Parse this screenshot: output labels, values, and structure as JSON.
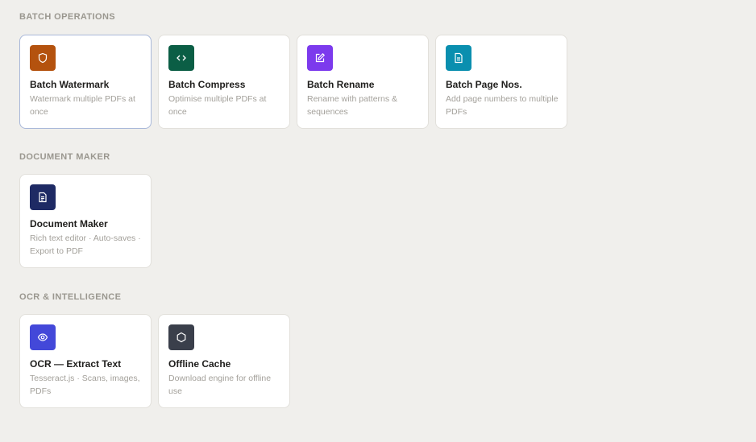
{
  "sections": [
    {
      "title": "BATCH OPERATIONS",
      "cards": [
        {
          "title": "Batch Watermark",
          "desc": "Watermark multiple PDFs at once",
          "icon": "shield-icon",
          "color": "#b4520e"
        },
        {
          "title": "Batch Compress",
          "desc": "Optimise multiple PDFs at once",
          "icon": "code-icon",
          "color": "#0b5e45"
        },
        {
          "title": "Batch Rename",
          "desc": "Rename with patterns & sequences",
          "icon": "edit-icon",
          "color": "#7c3aed"
        },
        {
          "title": "Batch Page Nos.",
          "desc": "Add page numbers to multiple PDFs",
          "icon": "file-icon",
          "color": "#0a8faf"
        }
      ]
    },
    {
      "title": "DOCUMENT MAKER",
      "cards": [
        {
          "title": "Document Maker",
          "desc": "Rich text editor · Auto-saves · Export to PDF",
          "icon": "document-icon",
          "color": "#1e2a64"
        }
      ]
    },
    {
      "title": "OCR & INTELLIGENCE",
      "cards": [
        {
          "title": "OCR — Extract Text",
          "desc": "Tesseract.js · Scans, images, PDFs",
          "icon": "eye-icon",
          "color": "#4348d9"
        },
        {
          "title": "Offline Cache",
          "desc": "Download engine for offline use",
          "icon": "hexagon-icon",
          "color": "#3a3f4b"
        }
      ]
    }
  ]
}
